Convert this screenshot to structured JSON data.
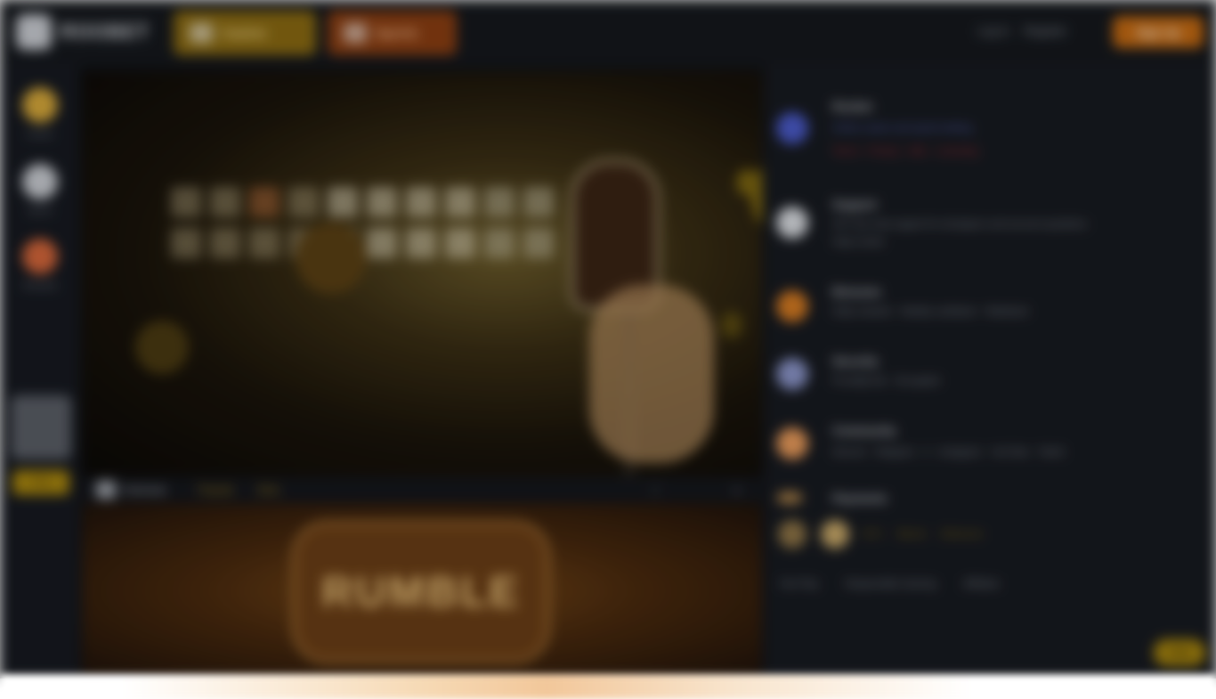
{
  "header": {
    "brand": "ROOBET",
    "promo_primary": "Casino",
    "promo_secondary": "Sports",
    "link_login": "Log In",
    "link_register": "Register",
    "signup_label": "Sign Up"
  },
  "rail": {
    "items": [
      {
        "label": "Casino",
        "color": "#d6a83a"
      },
      {
        "label": "Sports",
        "color": "#c9ccd2"
      },
      {
        "label": "Rewards",
        "color": "#d4663a"
      }
    ],
    "featured_label": "Play"
  },
  "game": {
    "provider": "Hacksaw",
    "tag1": "Popular",
    "tag2": "Slots",
    "fullscreen": "⛶",
    "theater": "▭"
  },
  "banner": {
    "title": "RUMBLE"
  },
  "feed": [
    {
      "title": "Roobet",
      "icon_color": "#4a5ac8",
      "lines": [
        "Online casino and sports betting",
        "Terms · Privacy · AML · Licensing"
      ]
    },
    {
      "title": "Support",
      "icon_color": "#d9dce1",
      "lines": [
        "24/7 live chat support for all players and account questions",
        "Help Center"
      ]
    },
    {
      "title": "Bonuses",
      "icon_color": "#d47a22",
      "lines": [
        "Daily rewards · Weekly cashback · Rakeback"
      ]
    },
    {
      "title": "Security",
      "icon_color": "#8a94c8",
      "lines": [
        "Provably fair · Encrypted"
      ]
    },
    {
      "title": "Community",
      "icon_color": "#e89a5a",
      "lines": [
        "Discord · Telegram · X · Instagram · YouTube · Twitch"
      ]
    },
    {
      "title": "Payments",
      "icon_color": "#b0844a",
      "lines": []
    }
  ],
  "payment_chips": [
    "BTC",
    "Bitcoin",
    "Ethereum"
  ],
  "footer_links": [
    "Fair Play",
    "Responsible Gaming",
    "Affiliates"
  ],
  "chat_label": "Chat"
}
